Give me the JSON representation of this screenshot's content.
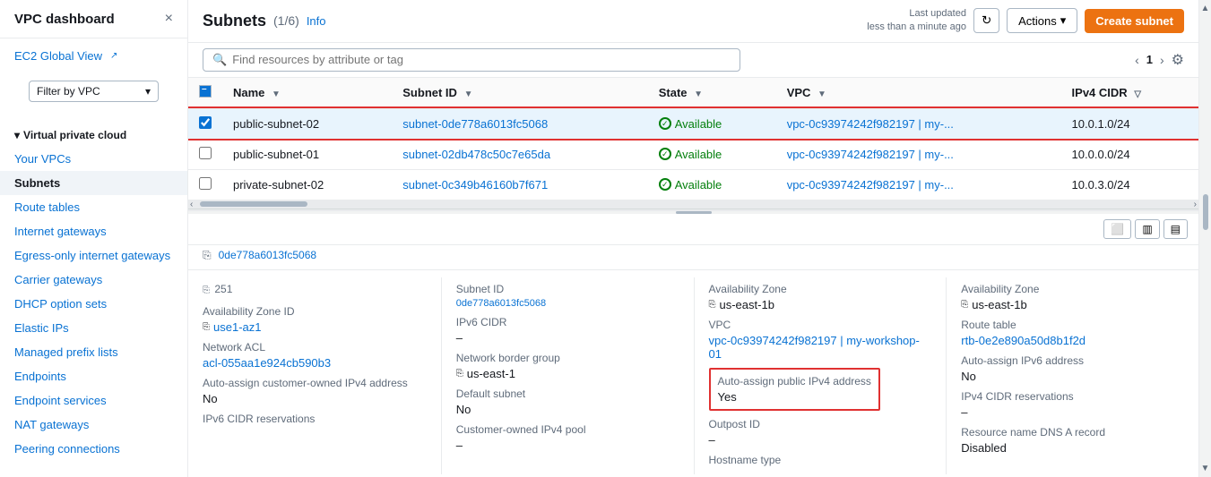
{
  "sidebar": {
    "title": "VPC dashboard",
    "close_icon": "×",
    "ec2_global_view": "EC2 Global View",
    "filter_label": "Filter by VPC",
    "section_label": "Virtual private cloud",
    "items": [
      {
        "label": "Your VPCs",
        "active": false
      },
      {
        "label": "Subnets",
        "active": true
      },
      {
        "label": "Route tables",
        "active": false
      },
      {
        "label": "Internet gateways",
        "active": false
      },
      {
        "label": "Egress-only internet gateways",
        "active": false
      },
      {
        "label": "Carrier gateways",
        "active": false
      },
      {
        "label": "DHCP option sets",
        "active": false
      },
      {
        "label": "Elastic IPs",
        "active": false
      },
      {
        "label": "Managed prefix lists",
        "active": false
      },
      {
        "label": "Endpoints",
        "active": false
      },
      {
        "label": "Endpoint services",
        "active": false
      },
      {
        "label": "NAT gateways",
        "active": false
      },
      {
        "label": "Peering connections",
        "active": false
      }
    ]
  },
  "header": {
    "title": "Subnets",
    "count": "(1/6)",
    "info_link": "Info",
    "last_updated_line1": "Last updated",
    "last_updated_line2": "less than a minute ago",
    "actions_label": "Actions",
    "create_label": "Create subnet"
  },
  "search": {
    "placeholder": "Find resources by attribute or tag"
  },
  "table": {
    "columns": [
      "Name",
      "Subnet ID",
      "State",
      "VPC",
      "IPv4 CIDR"
    ],
    "pagination": {
      "current": "1"
    },
    "rows": [
      {
        "id": "row-1",
        "selected": true,
        "name": "public-subnet-02",
        "subnet_id": "subnet-0de778a6013fc5068",
        "state": "Available",
        "vpc": "vpc-0c93974242f982197 | my-...",
        "ipv4_cidr": "10.0.1.0/24"
      },
      {
        "id": "row-2",
        "selected": false,
        "name": "public-subnet-01",
        "subnet_id": "subnet-02db478c50c7e65da",
        "state": "Available",
        "vpc": "vpc-0c93974242f982197 | my-...",
        "ipv4_cidr": "10.0.0.0/24"
      },
      {
        "id": "row-3",
        "selected": false,
        "name": "private-subnet-02",
        "subnet_id": "subnet-0c349b46160b7f671",
        "state": "Available",
        "vpc": "vpc-0c93974242f982197 | my-...",
        "ipv4_cidr": "10.0.3.0/24"
      }
    ]
  },
  "detail": {
    "subnet_id_top": "0de778a6013fc5068",
    "az_id_label": "Availability Zone ID",
    "az_id_value": "use1-az1",
    "az_id_copy": "copy",
    "network_acl_label": "Network ACL",
    "network_acl_value": "acl-055aa1e924cb590b3",
    "auto_assign_customer_label": "Auto-assign customer-owned IPv4 address",
    "auto_assign_customer_value": "No",
    "ipv6_cidr_reservations_label": "IPv6 CIDR reservations",
    "count_label": "251",
    "ipv6_cidr_label": "IPv6 CIDR",
    "ipv6_cidr_value": "–",
    "network_border_label": "Network border group",
    "network_border_value": "us-east-1",
    "default_subnet_label": "Default subnet",
    "default_subnet_value": "No",
    "customer_ipv4_label": "Customer-owned IPv4 pool",
    "customer_ipv4_value": "–",
    "vpc_label": "VPC",
    "vpc_value": "vpc-0c93974242f982197 | my-workshop-01",
    "outpost_id_label": "Outpost ID",
    "outpost_id_value": "–",
    "hostname_type_label": "Hostname type",
    "auto_assign_ipv4_label": "Auto-assign public IPv4 address",
    "auto_assign_ipv4_value": "Yes",
    "az_top_label": "us-east-1b",
    "route_table_label": "Route table",
    "route_table_value": "rtb-0e2e890a50d8b1f2d",
    "auto_assign_ipv6_label": "Auto-assign IPv6 address",
    "auto_assign_ipv6_value": "No",
    "ipv4_cidr_reservations_label": "IPv4 CIDR reservations",
    "ipv4_cidr_reservations_value": "–",
    "resource_name_dns_label": "Resource name DNS A record",
    "resource_name_dns_value": "Disabled"
  }
}
